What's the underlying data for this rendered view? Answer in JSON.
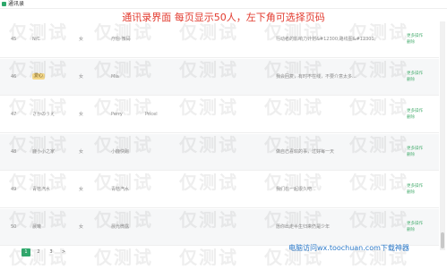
{
  "window": {
    "title": "通讯录"
  },
  "caption": "通讯录界面 每页显示50人，左下角可选择页码",
  "rows": [
    {
      "no": "45",
      "name": "N/C",
      "gender": "女",
      "nick": "疗愈·微码",
      "extra": "",
      "note": "行动者的影响力计划&#12300;路线图&#12301;",
      "actions": [
        "更多操作",
        "删除"
      ],
      "alt": false
    },
    {
      "no": "46",
      "name": "爱心",
      "gender": "女",
      "nick": "Mia",
      "extra": "",
      "note": "我会回复，有时不在线，不要介意太多...",
      "actions": [
        "更多操作",
        "删除"
      ],
      "alt": true
    },
    {
      "no": "47",
      "name": "さかのうえ",
      "gender": "女",
      "nick": "Perry",
      "extra": "Pricel",
      "note": "",
      "actions": [
        "更多操作",
        "删除"
      ],
      "alt": false
    },
    {
      "no": "48",
      "name": "鹿小小之家",
      "gender": "女",
      "nick": "小鹿快跑",
      "extra": "",
      "note": "做自己喜欢的事，过好每一天",
      "actions": [
        "更多操作",
        "删除"
      ],
      "alt": true
    },
    {
      "no": "49",
      "name": "青桔汽水",
      "gender": "女",
      "nick": "青桔汽水",
      "extra": "",
      "note": "我们在一起很久吧...",
      "actions": [
        "更多操作",
        "删除"
      ],
      "alt": false
    },
    {
      "no": "50",
      "name": "晨曦",
      "gender": "女",
      "nick": "晨光微露",
      "extra": "",
      "note": "愿你出走半生归来仍是少年",
      "actions": [
        "更多操作",
        "删除"
      ],
      "alt": true
    }
  ],
  "pager": {
    "pages": [
      "1",
      "2",
      "3",
      ">"
    ],
    "active_index": 0
  },
  "footer_note": "电脑访问wx.toochuan.com下载神器",
  "watermark": "仅测试",
  "colors": {
    "accent": "#2ea86b",
    "caption": "#e23a2e",
    "link": "#2a78c8"
  }
}
